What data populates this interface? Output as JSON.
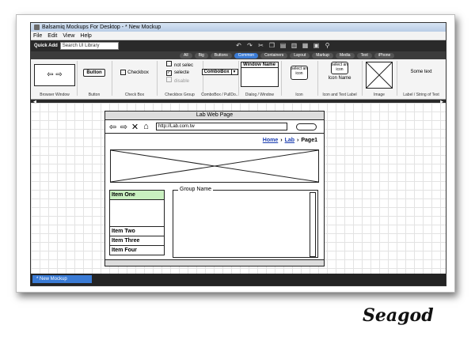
{
  "window": {
    "title": "Balsamiq Mockups For Desktop - * New Mockup"
  },
  "menu": [
    "File",
    "Edit",
    "View",
    "Help"
  ],
  "toolbar": {
    "quick_add_label": "Quick Add",
    "search_placeholder": "Search UI Library"
  },
  "tabs": [
    {
      "label": "All",
      "active": false
    },
    {
      "label": "Big",
      "active": false
    },
    {
      "label": "Buttons",
      "active": false
    },
    {
      "label": "Common",
      "active": true
    },
    {
      "label": "Containers",
      "active": false
    },
    {
      "label": "Layout",
      "active": false
    },
    {
      "label": "Markup",
      "active": false
    },
    {
      "label": "Media",
      "active": false
    },
    {
      "label": "Text",
      "active": false
    },
    {
      "label": "iPhone",
      "active": false
    }
  ],
  "library": {
    "browser": "Browser Window",
    "button": "Button",
    "button_text": "Button",
    "checkbox": "Check Box",
    "checkbox_text": "Checkbox",
    "checkbox_group": "Checkbox Group",
    "cbg_items": [
      "not selec",
      "selecte",
      "disable"
    ],
    "combobox": "ComboBox / PullDo...",
    "combobox_text": "ComboBox",
    "dialog": "Dialog / Window",
    "window_name": "Window Name",
    "icon": "Icon",
    "icon_text": "select an icon",
    "icon_label": "Icon and Text Label",
    "icon_name": "Icon Name",
    "image": "Image",
    "label": "Label / String of Text",
    "some_text": "Some text"
  },
  "bottom": {
    "doc_tab": "* New Mockup"
  },
  "mockup": {
    "title": "Lab Web Page",
    "url": "http://Lab.com.tw",
    "breadcrumb": {
      "home": "Home",
      "lab": "Lab",
      "page": "Page1"
    },
    "list_items": [
      "Item One",
      "Item Two",
      "Item Three",
      "Item Four"
    ],
    "group_name": "Group Name"
  },
  "signature": "Seagod"
}
